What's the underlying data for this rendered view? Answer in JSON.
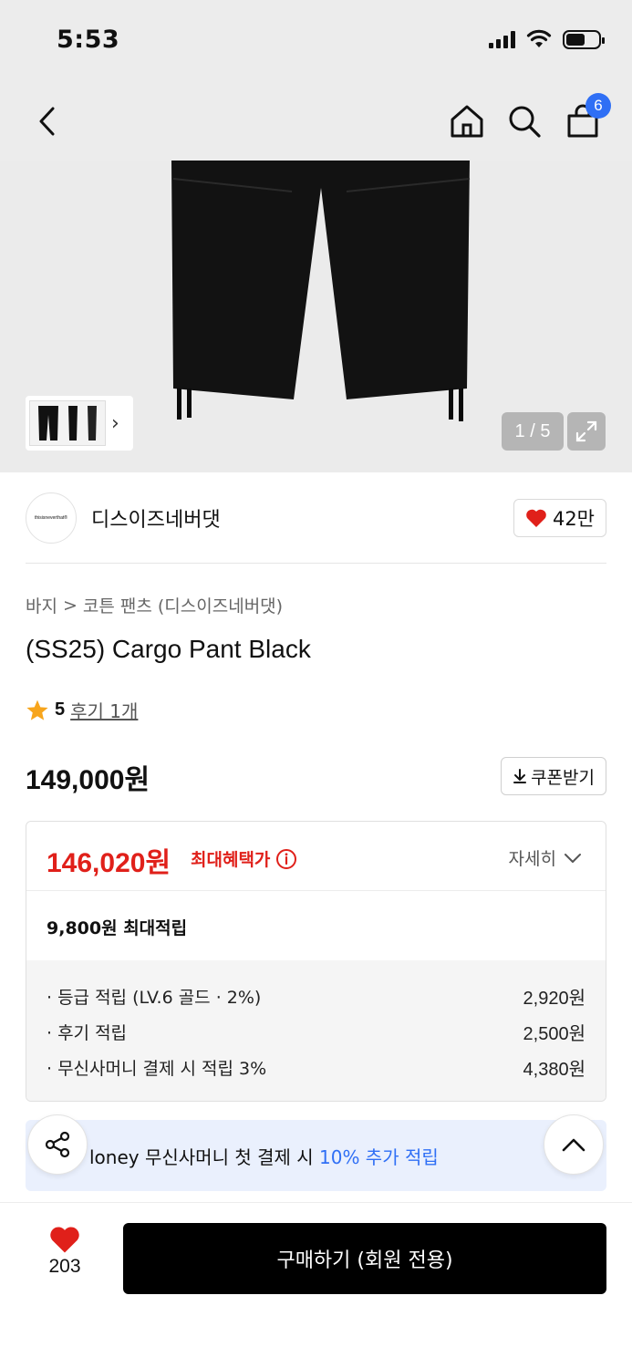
{
  "status_bar": {
    "time": "5:53"
  },
  "nav": {
    "cart_count": "6"
  },
  "gallery": {
    "counter": "1 / 5"
  },
  "brand": {
    "logo_text": "thisisneverthat®",
    "name": "디스이즈네버댓",
    "likes": "42만"
  },
  "breadcrumb": {
    "category": "바지",
    "separator": ">",
    "subcategory": "코튼 팬츠 (디스이즈네버댓)"
  },
  "product": {
    "title": "(SS25) Cargo Pant Black",
    "rating": "5",
    "review_link": "후기 1개",
    "price": "149,000원"
  },
  "coupon": {
    "label": "쿠폰받기"
  },
  "benefit": {
    "max_price": "146,020원",
    "max_label": "최대혜택가",
    "detail_label": "자세히",
    "points_max": "9,800원 최대적립",
    "points": [
      {
        "label": "· 등급 적립 (LV.6 골드 · 2%)",
        "value": "2,920원"
      },
      {
        "label": "· 후기 적립",
        "value": "2,500원"
      },
      {
        "label": "· 무신사머니 결제 시 적립 3%",
        "value": "4,380원"
      }
    ]
  },
  "promo": {
    "prefix": "loney 무신사머니 첫 결제 시 ",
    "highlight": "10% 추가 적립"
  },
  "bottom": {
    "wish_count": "203",
    "buy_label": "구매하기 (회원 전용)"
  },
  "colors": {
    "accent_red": "#e0201a",
    "accent_blue": "#2f6ff5",
    "promo_bg": "#eaf0fd",
    "buy_bg": "#000000"
  }
}
